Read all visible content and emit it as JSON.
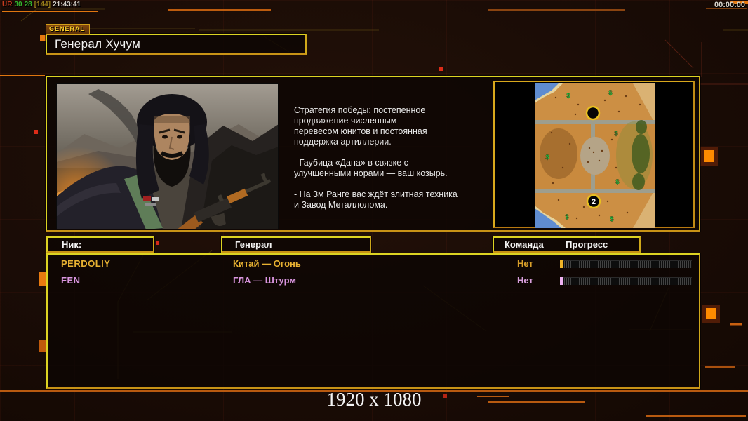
{
  "status_bar": {
    "fps_prefix": "UR",
    "fps_value": "30",
    "frame_value": "28",
    "bracket_value": "[144]",
    "clock": "21:43:41",
    "match_timer": "00:00:00"
  },
  "header": {
    "tab_label": "GENERAL",
    "title": "Генерал Хучум"
  },
  "general": {
    "portrait_name": "gla-general-with-ak47",
    "description_lines": [
      "Стратегия победы: постепенное",
      "продвижение численным",
      "перевесом юнитов и постоянная",
      "поддержка артиллерии.",
      "",
      "- Гаубица «Дана» в связке с",
      "улучшенными норами — ваш козырь.",
      "",
      "- На 3м Ранге вас ждёт элитная техника",
      "и Завод Металлолома."
    ]
  },
  "minimap": {
    "start_label": "2",
    "supply_symbol": "$"
  },
  "players": {
    "headers": {
      "nick": "Ник:",
      "general": "Генерал",
      "team": "Команда",
      "progress": "Прогресс"
    },
    "rows": [
      {
        "nick": "PERDOLIY",
        "general": "Китай — Огонь",
        "team": "Нет",
        "progress_percent": 2,
        "color": "#e8b232"
      },
      {
        "nick": "FEN",
        "general": "ГЛА — Штурм",
        "team": "Нет",
        "progress_percent": 2,
        "color": "#da96e0"
      }
    ]
  },
  "footer": {
    "resolution": "1920 x 1080"
  },
  "colors": {
    "panel_border_yellow": "#dcd322",
    "accent_orange": "#e0760f",
    "background": "#1a0c06",
    "row_gold": "#e8b232",
    "row_pink": "#da96e0"
  }
}
